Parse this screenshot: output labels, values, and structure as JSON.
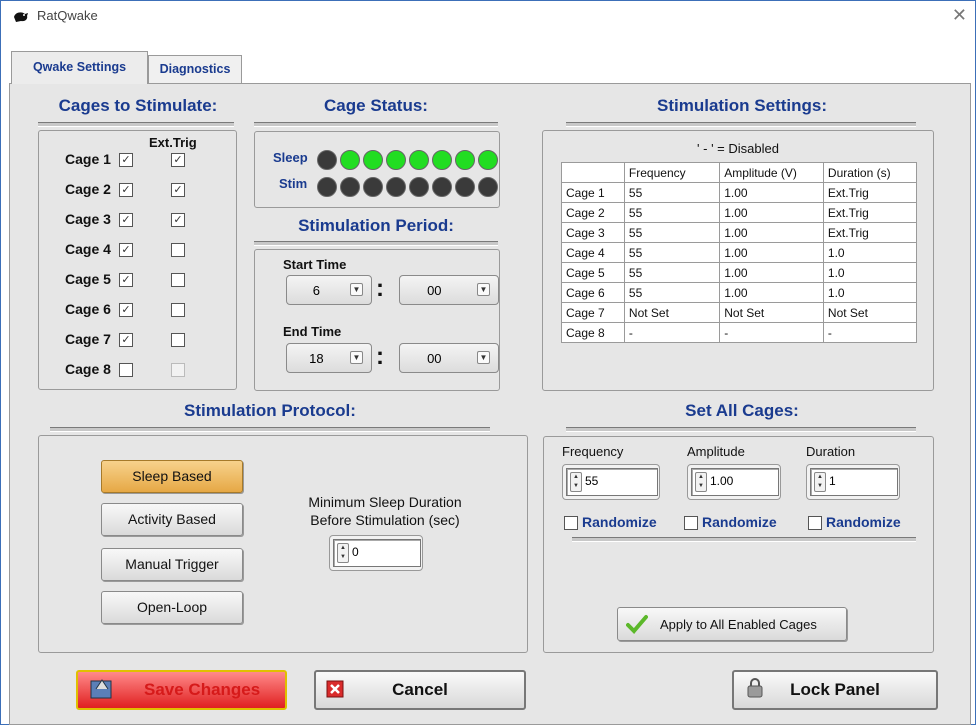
{
  "window": {
    "title": "RatQwake"
  },
  "tabs": [
    {
      "label": "Qwake Settings"
    },
    {
      "label": "Diagnostics"
    }
  ],
  "cages_section": {
    "title": "Cages to Stimulate:",
    "ext_trig_header": "Ext.Trig",
    "cages": [
      {
        "label": "Cage 1",
        "enabled": true,
        "ext_trig": true
      },
      {
        "label": "Cage 2",
        "enabled": true,
        "ext_trig": true
      },
      {
        "label": "Cage 3",
        "enabled": true,
        "ext_trig": true
      },
      {
        "label": "Cage 4",
        "enabled": true,
        "ext_trig": false
      },
      {
        "label": "Cage 5",
        "enabled": true,
        "ext_trig": false
      },
      {
        "label": "Cage 6",
        "enabled": true,
        "ext_trig": false
      },
      {
        "label": "Cage 7",
        "enabled": true,
        "ext_trig": false
      },
      {
        "label": "Cage 8",
        "enabled": false,
        "ext_trig": false
      }
    ]
  },
  "cage_status": {
    "title": "Cage Status:",
    "sleep_label": "Sleep",
    "stim_label": "Stim",
    "sleep": [
      false,
      true,
      true,
      true,
      true,
      true,
      true,
      true
    ],
    "stim": [
      false,
      false,
      false,
      false,
      false,
      false,
      false,
      false
    ],
    "on_color": "#22dd22",
    "off_color": "#3a3a3a"
  },
  "stim_period": {
    "title": "Stimulation Period:",
    "start_label": "Start Time",
    "start_hour": "6",
    "start_min": "00",
    "end_label": "End Time",
    "end_hour": "18",
    "end_min": "00",
    "colon": ":"
  },
  "stim_settings": {
    "title": "Stimulation Settings:",
    "note": "' - ' = Disabled",
    "headers": [
      "",
      "Frequency",
      "Amplitude (V)",
      "Duration (s)"
    ],
    "rows": [
      [
        "Cage 1",
        "55",
        "1.00",
        "Ext.Trig"
      ],
      [
        "Cage 2",
        "55",
        "1.00",
        "Ext.Trig"
      ],
      [
        "Cage 3",
        "55",
        "1.00",
        "Ext.Trig"
      ],
      [
        "Cage 4",
        "55",
        "1.00",
        "1.0"
      ],
      [
        "Cage 5",
        "55",
        "1.00",
        "1.0"
      ],
      [
        "Cage 6",
        "55",
        "1.00",
        "1.0"
      ],
      [
        "Cage 7",
        "Not Set",
        "Not Set",
        "Not Set"
      ],
      [
        "Cage 8",
        "-",
        "-",
        "-"
      ]
    ]
  },
  "protocol": {
    "title": "Stimulation Protocol:",
    "buttons": [
      "Sleep Based",
      "Activity Based",
      "Manual Trigger",
      "Open-Loop"
    ],
    "selected_index": 0,
    "min_sleep_label_1": "Minimum Sleep Duration",
    "min_sleep_label_2": "Before Stimulation (sec)",
    "min_sleep_value": "0"
  },
  "set_all": {
    "title": "Set All Cages:",
    "frequency_label": "Frequency",
    "frequency_value": "55",
    "amplitude_label": "Amplitude",
    "amplitude_value": "1.00",
    "duration_label": "Duration",
    "duration_value": "1",
    "randomize_label": "Randomize",
    "apply_label": "Apply to All Enabled Cages"
  },
  "footer": {
    "save_label": "Save Changes",
    "cancel_label": "Cancel",
    "lock_label": "Lock Panel",
    "save_color": "#e02020",
    "accent_color": "#1a3b8f"
  }
}
